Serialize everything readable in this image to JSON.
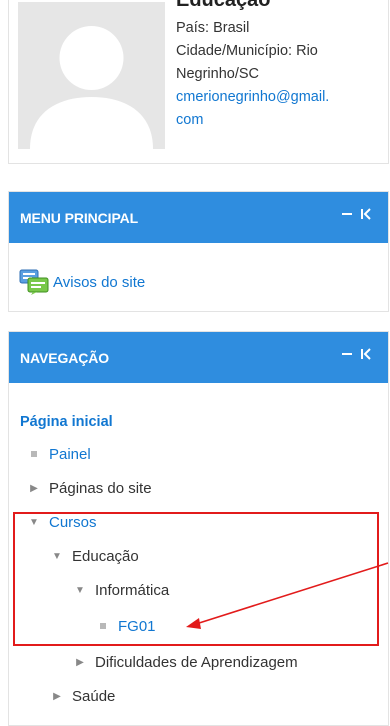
{
  "profile": {
    "name": "Educação",
    "country_line": "País: Brasil",
    "city_line_1": "Cidade/Município: Rio",
    "city_line_2": "Negrinho/SC",
    "email_line_1": "cmerionegrinho@gmail.",
    "email_line_2": "com"
  },
  "main_menu": {
    "title": "MENU PRINCIPAL",
    "items": [
      {
        "label": "Avisos do site",
        "icon": "forum-icon"
      }
    ]
  },
  "navigation": {
    "title": "NAVEGAÇÃO",
    "home": "Página inicial",
    "items": [
      {
        "label": "Painel"
      },
      {
        "label": "Páginas do site"
      },
      {
        "label": "Cursos"
      },
      {
        "label": "Educação"
      },
      {
        "label": "Informática"
      },
      {
        "label": "FG01"
      },
      {
        "label": "Dificuldades de Aprendizagem"
      },
      {
        "label": "Saúde"
      }
    ]
  },
  "colors": {
    "header_bg": "#2f8ddf",
    "link": "#1177d1",
    "annotation": "#e21b1b"
  }
}
